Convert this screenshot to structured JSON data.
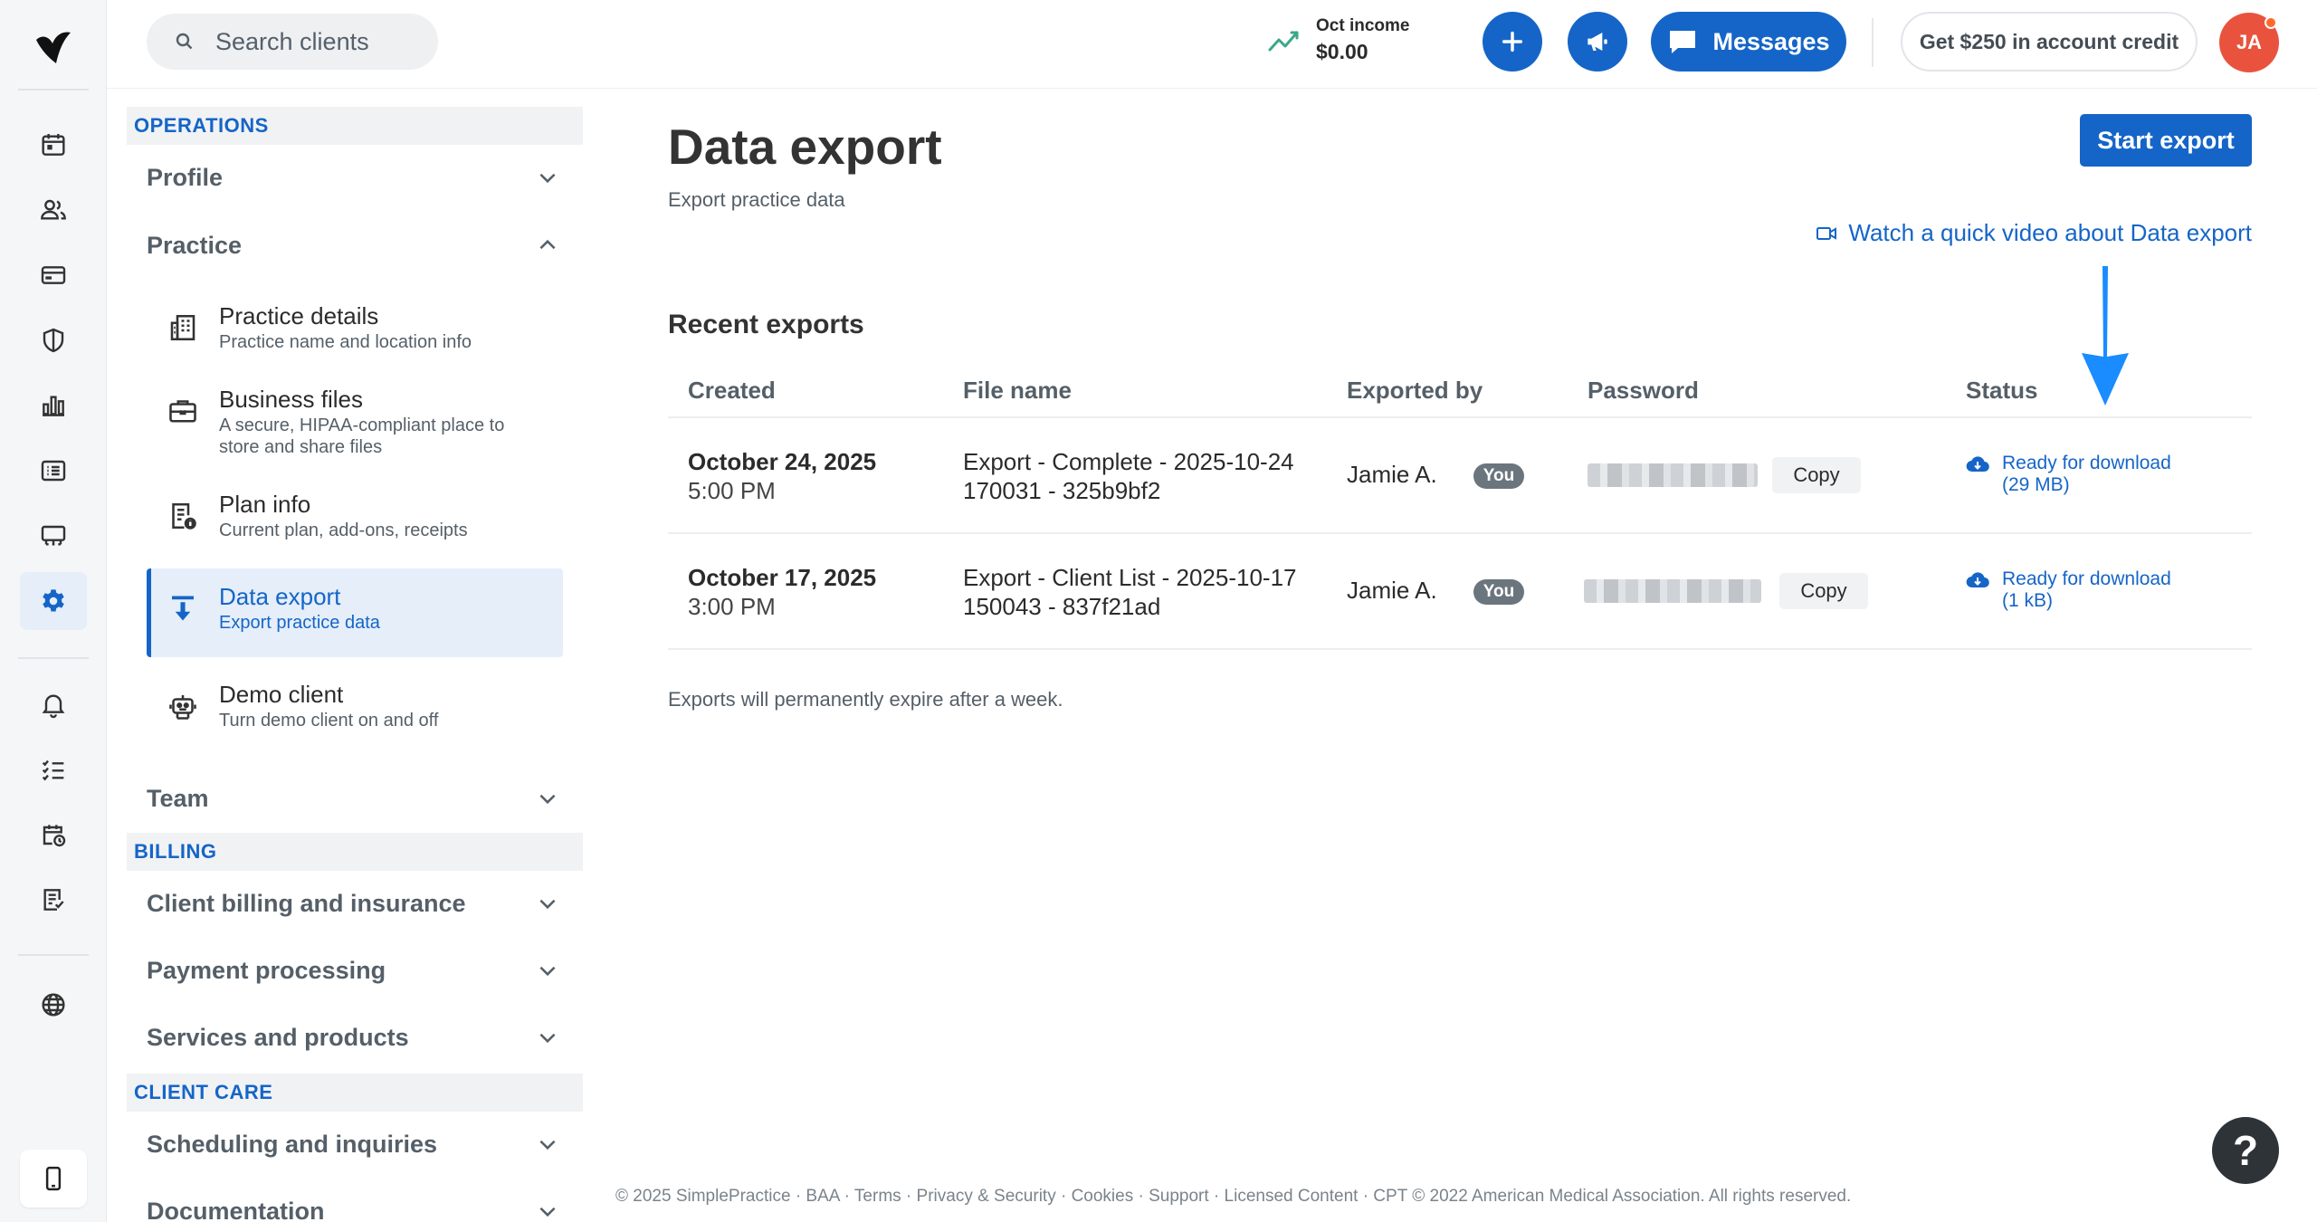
{
  "topbar": {
    "search_placeholder": "Search clients",
    "income_label": "Oct income",
    "income_value": "$0.00",
    "messages_label": "Messages",
    "credit_label": "Get $250 in account credit",
    "avatar_initials": "JA"
  },
  "rail": {
    "icons": [
      "calendar-icon",
      "clients-icon",
      "billing-card-icon",
      "insurance-shield-icon",
      "analytics-chart-icon",
      "activity-list-icon",
      "marketplace-store-icon",
      "settings-gear-icon",
      "notifications-bell-icon",
      "tasks-list-icon",
      "requests-calendar-icon",
      "reports-icon",
      "globe-icon",
      "mobile-app-icon"
    ],
    "active": "settings-gear-icon"
  },
  "sidenav": {
    "operations_heading": "OPERATIONS",
    "profile": "Profile",
    "practice": "Practice",
    "items": [
      {
        "title": "Practice details",
        "desc": "Practice name and location info"
      },
      {
        "title": "Business files",
        "desc_line1": "A secure, HIPAA-compliant place to",
        "desc_line2": "store and share files"
      },
      {
        "title": "Plan info",
        "desc": "Current plan, add-ons, receipts"
      },
      {
        "title": "Data export",
        "desc": "Export practice data"
      },
      {
        "title": "Demo client",
        "desc": "Turn demo client on and off"
      }
    ],
    "team": "Team",
    "billing_heading": "BILLING",
    "client_billing": "Client billing and insurance",
    "payment_processing": "Payment processing",
    "services_products": "Services and products",
    "client_care_heading": "CLIENT CARE",
    "scheduling": "Scheduling and inquiries",
    "documentation": "Documentation"
  },
  "main": {
    "title": "Data export",
    "subtitle": "Export practice data",
    "start_export": "Start export",
    "video_link": "Watch a quick video about Data export",
    "recent_title": "Recent exports",
    "columns": [
      "Created",
      "File name",
      "Exported by",
      "Password",
      "Status"
    ],
    "rows": [
      {
        "date": "October 24, 2025",
        "time": "5:00 PM",
        "file_line1": "Export - Complete - 2025-10-24",
        "file_line2": "170031 - 325b9bf2",
        "exported_by": "Jamie A.",
        "you": "You",
        "copy": "Copy",
        "status_line1": "Ready for download",
        "status_line2": "(29 MB)"
      },
      {
        "date": "October 17, 2025",
        "time": "3:00 PM",
        "file_line1": "Export - Client List - 2025-10-17",
        "file_line2": "150043 - 837f21ad",
        "exported_by": "Jamie A.",
        "you": "You",
        "copy": "Copy",
        "status_line1": "Ready for download",
        "status_line2": "(1 kB)"
      }
    ],
    "expire_note": "Exports will permanently expire after a week."
  },
  "footer": {
    "text": "© 2025 SimplePractice · BAA · Terms · Privacy & Security · Cookies · Support · Licensed Content · CPT © 2022 American Medical Association. All rights reserved."
  },
  "help_label": "?",
  "colors": {
    "accent": "#1565c8",
    "active_bg": "#e5eef9",
    "avatar": "#e9533d",
    "annotation_arrow": "#1a8cff"
  }
}
